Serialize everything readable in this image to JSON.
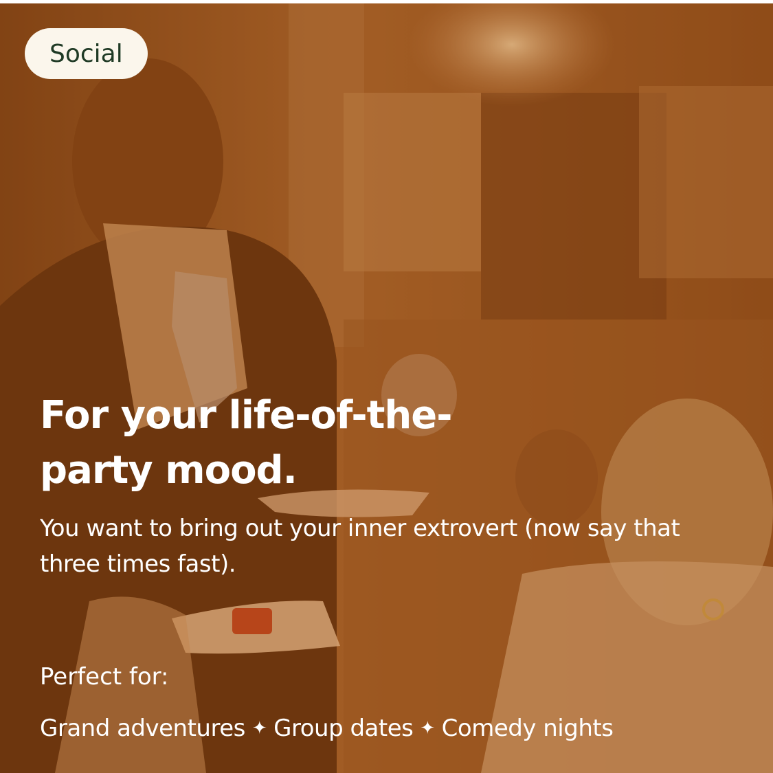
{
  "badge": {
    "label": "Social"
  },
  "headline": {
    "line1": "For your life-of-the-",
    "line2": "party mood."
  },
  "description": "You want to bring out your inner extrovert (now say that three times fast).",
  "perfect_for": {
    "label": "Perfect for:",
    "separator": "✦",
    "tags": [
      "Grand adventures",
      "Group dates",
      "Comedy nights"
    ]
  },
  "colors": {
    "overlay": "#96501a",
    "badge_bg": "#fbf6ec",
    "badge_text": "#1f3a25",
    "text": "#ffffff"
  },
  "background_image": "restaurant-scene-photo"
}
